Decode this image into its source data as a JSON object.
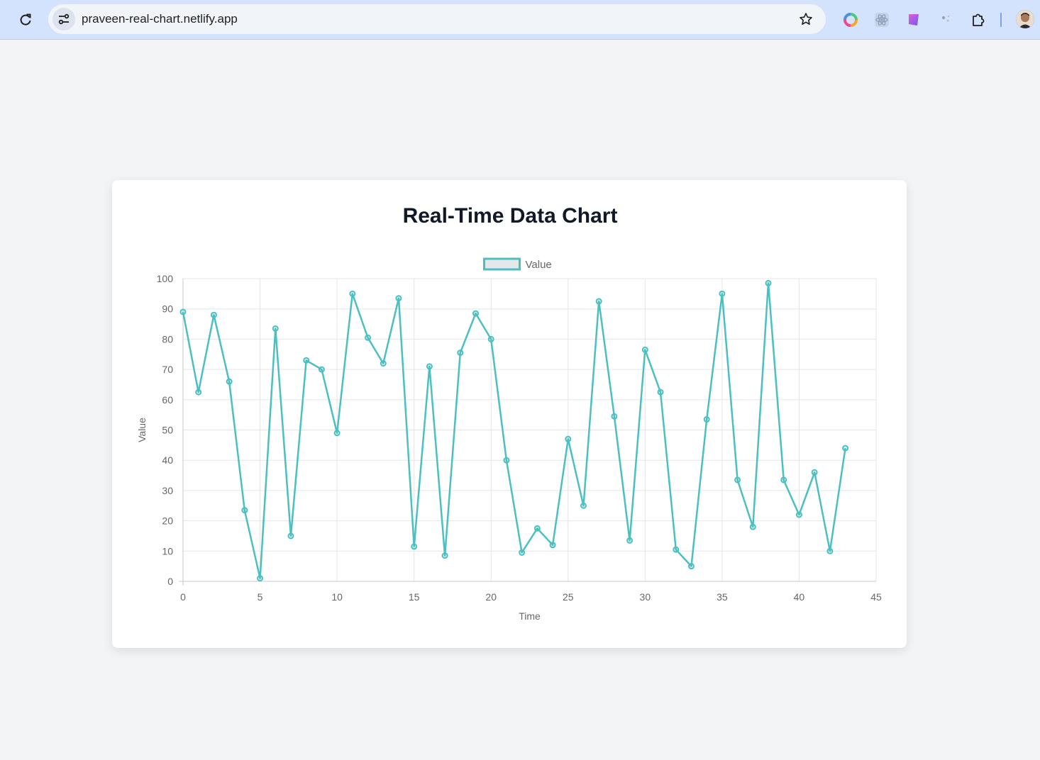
{
  "browser": {
    "url": "praveen-real-chart.netlify.app",
    "extensions": [
      "color-wheel-icon",
      "react-devtools-icon",
      "gradient-shape-icon",
      "sparkle-icon",
      "puzzle-icon"
    ]
  },
  "page": {
    "title": "Real-Time Data Chart"
  },
  "colors": {
    "line": "#4bc0c0",
    "legend_fill": "#e5e7eb",
    "grid": "#e5e5e5",
    "tick": "#666666"
  },
  "chart_data": {
    "type": "line",
    "title": "Real-Time Data Chart",
    "xlabel": "Time",
    "ylabel": "Value",
    "xlim": [
      0,
      45
    ],
    "ylim": [
      0,
      100
    ],
    "xticks": [
      0,
      5,
      10,
      15,
      20,
      25,
      30,
      35,
      40,
      45
    ],
    "yticks": [
      0,
      10,
      20,
      30,
      40,
      50,
      60,
      70,
      80,
      90,
      100
    ],
    "grid": true,
    "legend": "top-center",
    "series": [
      {
        "name": "Value",
        "x": [
          0,
          1,
          2,
          3,
          4,
          5,
          6,
          7,
          8,
          9,
          10,
          11,
          12,
          13,
          14,
          15,
          16,
          17,
          18,
          19,
          20,
          21,
          22,
          23,
          24,
          25,
          26,
          27,
          28,
          29,
          30,
          31,
          32,
          33,
          34,
          35,
          36,
          37,
          38,
          39,
          40,
          41,
          42,
          43
        ],
        "y": [
          89,
          62.5,
          88,
          66,
          23.5,
          1,
          83.5,
          15,
          73,
          70,
          49,
          95,
          80.5,
          72,
          93.5,
          11.5,
          71,
          8.5,
          75.5,
          88.5,
          80,
          40,
          9.5,
          17.5,
          12,
          47,
          25,
          92.5,
          54.5,
          13.5,
          76.5,
          62.5,
          10.5,
          5,
          53.5,
          95,
          33.5,
          18,
          98.5,
          33.5,
          22,
          36,
          10,
          44
        ]
      }
    ]
  }
}
